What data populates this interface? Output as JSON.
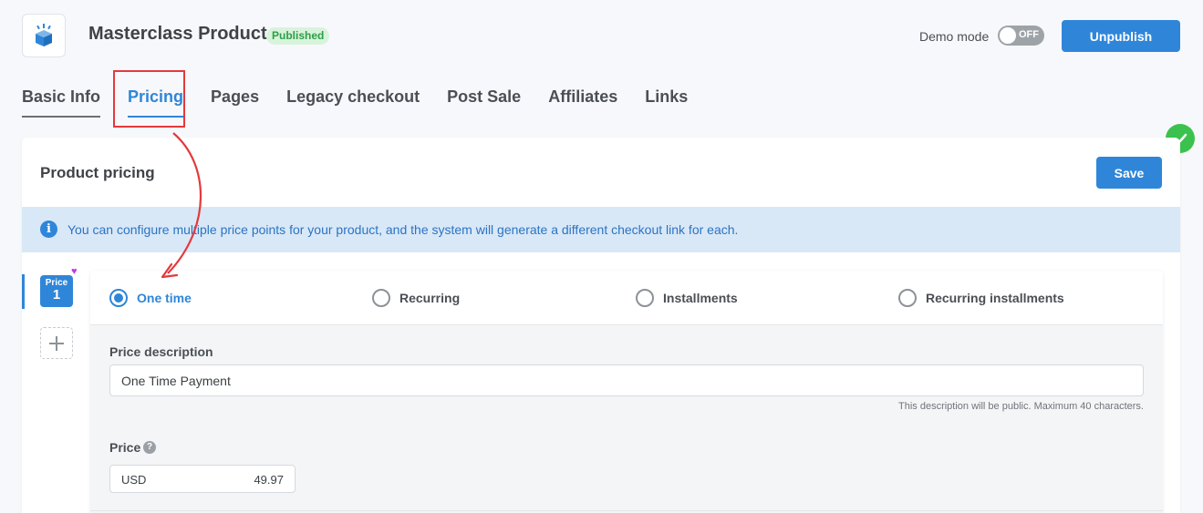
{
  "header": {
    "title": "Masterclass Product",
    "status": "Published",
    "demo_mode_label": "Demo mode",
    "demo_mode_state": "OFF",
    "unpublish_label": "Unpublish"
  },
  "tabs": [
    {
      "label": "Basic Info"
    },
    {
      "label": "Pricing"
    },
    {
      "label": "Pages"
    },
    {
      "label": "Legacy checkout"
    },
    {
      "label": "Post Sale"
    },
    {
      "label": "Affiliates"
    },
    {
      "label": "Links"
    }
  ],
  "active_tab": "Pricing",
  "card": {
    "title": "Product pricing",
    "save_label": "Save",
    "info_message": "You can configure multiple price points for your product, and the system will generate a different checkout link for each."
  },
  "prices": {
    "chip_label": "Price",
    "chip_number": "1"
  },
  "payment_types": {
    "options": [
      "One time",
      "Recurring",
      "Installments",
      "Recurring installments"
    ],
    "selected": "One time"
  },
  "form": {
    "description_label": "Price description",
    "description_value": "One Time Payment",
    "description_hint": "This description will be public. Maximum 40 characters.",
    "price_label": "Price",
    "currency": "USD",
    "amount": "49.97"
  },
  "colors": {
    "accent": "#2f86d9",
    "success": "#3bc24e",
    "annotation": "#e4393c"
  }
}
